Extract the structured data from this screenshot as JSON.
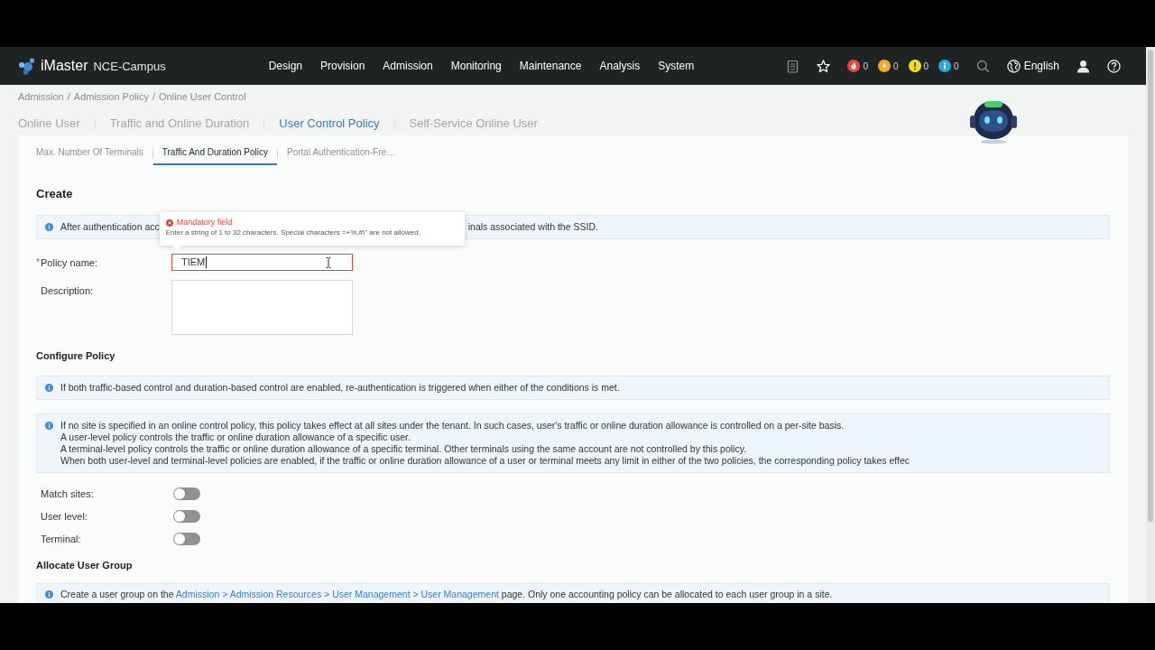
{
  "nav": {
    "brand": "iMaster",
    "product": "NCE-Campus",
    "menu": [
      {
        "label": "Design"
      },
      {
        "label": "Provision"
      },
      {
        "label": "Admission"
      },
      {
        "label": "Monitoring"
      },
      {
        "label": "Maintenance"
      },
      {
        "label": "Analysis"
      },
      {
        "label": "System"
      }
    ],
    "alarms": [
      {
        "kind": "critical",
        "count": "0",
        "color": "#e8453c"
      },
      {
        "kind": "major",
        "count": "0",
        "color": "#f5a623"
      },
      {
        "kind": "minor",
        "count": "0",
        "color": "#f2dc1c"
      },
      {
        "kind": "info",
        "count": "0",
        "color": "#29a8e0"
      }
    ],
    "language": "English"
  },
  "breadcrumb": {
    "separator": "/",
    "items": [
      "Admission",
      "Admission Policy",
      "Online User Control"
    ]
  },
  "tabs": [
    {
      "label": "Online User",
      "selected": false
    },
    {
      "label": "Traffic and Online Duration",
      "selected": false
    },
    {
      "label": "User Control Policy",
      "selected": true
    },
    {
      "label": "Self-Service Online User",
      "selected": false
    }
  ],
  "subtabs": [
    {
      "label": "Max. Number Of Terminals",
      "selected": false
    },
    {
      "label": "Traffic And Duration Policy",
      "selected": true
    },
    {
      "label": "Portal Authentication-Fre…",
      "selected": false
    }
  ],
  "create": {
    "title": "Create",
    "required_mark": "*",
    "notice": {
      "before": "After authentication acc",
      "after": "inals associated with the SSID."
    },
    "tooltip": {
      "title": "Mandatory field",
      "message": "Enter a string of 1 to 32 characters. Special characters =+%,#\\\" are not allowed."
    },
    "fields": [
      {
        "kind": "text",
        "label": "Policy name:",
        "required": true,
        "value": "TIEM",
        "error": true
      },
      {
        "kind": "textarea",
        "label": "Description:",
        "required": false,
        "error": false
      }
    ]
  },
  "policy": {
    "title": "Configure Policy",
    "notices": [
      {
        "lines": [
          "If both traffic-based control and duration-based control are enabled, re-authentication is triggered when either of the conditions is met."
        ]
      },
      {
        "lines": [
          "If no site is specified in an online control policy, this policy takes effect at all sites under the tenant. In such cases, user's traffic or online duration allowance is controlled on a per-site basis.",
          "A user-level policy controls the traffic or online duration allowance of a specific user.",
          "A terminal-level policy controls the traffic or online duration allowance of a specific terminal. Other terminals using the same account are not controlled by this policy.",
          "When both user-level and terminal-level policies are enabled, if the traffic or online duration allowance of a user or terminal meets any limit in either of the two policies, the corresponding policy takes effec"
        ]
      }
    ],
    "switches": [
      {
        "label": "Match sites:",
        "on": false
      },
      {
        "label": "User level:",
        "on": false
      },
      {
        "label": "Terminal:",
        "on": false
      }
    ]
  },
  "allocate": {
    "title": "Allocate User Group",
    "notice": {
      "before": "Create a user group on the",
      "link": "Admission > Admission Resources > User Management > User Management",
      "after": "page. Only one accounting policy can be allocated to each user group in a site."
    }
  }
}
